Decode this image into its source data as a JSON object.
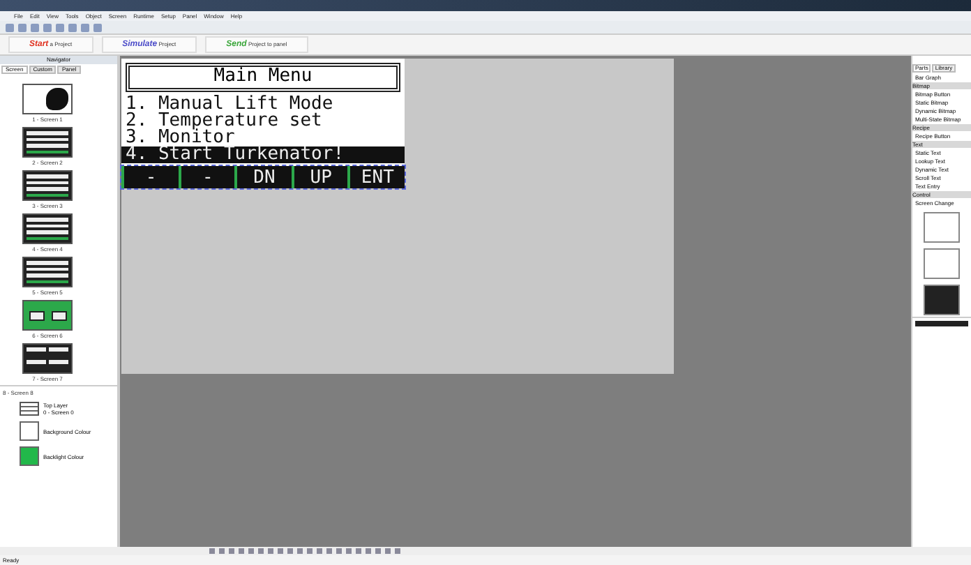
{
  "menu": [
    "File",
    "Edit",
    "View",
    "Tools",
    "Object",
    "Screen",
    "Runtime",
    "Setup",
    "Panel",
    "Window",
    "Help"
  ],
  "project_tabs": [
    {
      "word": "Start",
      "rest": "a Project",
      "color": "#e0301e"
    },
    {
      "word": "Simulate",
      "rest": "Project",
      "color": "#4a4ac8"
    },
    {
      "word": "Send",
      "rest": "Project to panel",
      "color": "#3aa63a"
    }
  ],
  "navigator": {
    "title": "Navigator",
    "tabs": [
      {
        "label": "Screen",
        "selected": true
      },
      {
        "label": "Custom",
        "selected": false
      },
      {
        "label": "Panel",
        "selected": false
      }
    ],
    "screens": [
      {
        "label": "1 - Screen 1",
        "kind": "image"
      },
      {
        "label": "2 - Screen 2",
        "kind": "menu"
      },
      {
        "label": "3 - Screen 3",
        "kind": "menu"
      },
      {
        "label": "4 - Screen 4",
        "kind": "menu"
      },
      {
        "label": "5 - Screen 5",
        "kind": "menu"
      },
      {
        "label": "6 - Screen 6",
        "kind": "buttons"
      },
      {
        "label": "7 - Screen 7",
        "kind": "grid"
      }
    ]
  },
  "properties": {
    "title": "8 - Screen 8",
    "items": [
      {
        "label": "Top Layer",
        "value": "0 - Screen 0",
        "kind": "layer"
      },
      {
        "label": "Background Colour",
        "kind": "swatch",
        "color": "#ffffff"
      },
      {
        "label": "Backlight Colour",
        "kind": "swatch",
        "color": "#22b84a"
      }
    ]
  },
  "hmi": {
    "title": "Main Menu",
    "items": [
      {
        "text": "1. Manual Lift Mode",
        "selected": false
      },
      {
        "text": "2. Temperature set",
        "selected": false
      },
      {
        "text": "3. Monitor",
        "selected": false
      },
      {
        "text": "4. Start Turkenator!",
        "selected": true
      }
    ],
    "keys": [
      "-",
      "-",
      "DN",
      "UP",
      "ENT"
    ]
  },
  "parts": {
    "tabs": [
      {
        "label": "Parts",
        "selected": true
      },
      {
        "label": "Library",
        "selected": false
      }
    ],
    "items": [
      {
        "text": "Bar Graph",
        "kind": "item"
      },
      {
        "text": "Bitmap",
        "kind": "header"
      },
      {
        "text": "Bitmap Button",
        "kind": "item"
      },
      {
        "text": "Static Bitmap",
        "kind": "item"
      },
      {
        "text": "Dynamic Bitmap",
        "kind": "item"
      },
      {
        "text": "Multi-State Bitmap",
        "kind": "item"
      },
      {
        "text": "Recipe",
        "kind": "header"
      },
      {
        "text": "Recipe Button",
        "kind": "item"
      },
      {
        "text": "Text",
        "kind": "header"
      },
      {
        "text": "Static Text",
        "kind": "item"
      },
      {
        "text": "Lookup Text",
        "kind": "item"
      },
      {
        "text": "Dynamic Text",
        "kind": "item"
      },
      {
        "text": "Scroll Text",
        "kind": "item"
      },
      {
        "text": "Text Entry",
        "kind": "item"
      },
      {
        "text": "Control",
        "kind": "header"
      },
      {
        "text": "Screen Change",
        "kind": "item"
      }
    ]
  },
  "status": "Ready"
}
